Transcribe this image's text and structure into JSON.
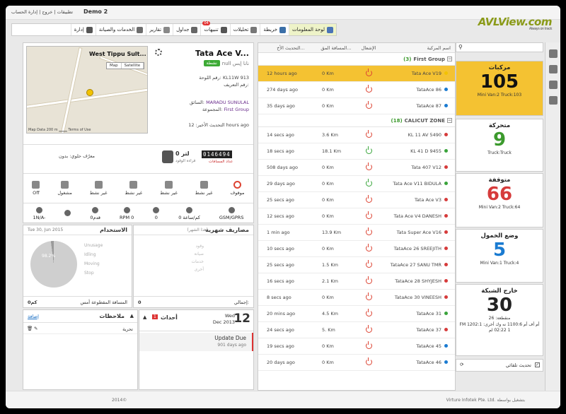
{
  "top": {
    "links": "تطبيقات | خروج | إدارة الحساب",
    "company": "Demo 2",
    "logo": "AVLView.com",
    "logo_tagline": "Always on track"
  },
  "menu": [
    {
      "label": "لوحة المعلومات",
      "icon": "dashboard-icon",
      "active": true
    },
    {
      "label": "خريطة",
      "icon": "globe-icon"
    },
    {
      "label": "تحليلات",
      "icon": "chart-icon"
    },
    {
      "label": "تنبيهات",
      "icon": "warning-icon",
      "badge": "04"
    },
    {
      "label": "جداول",
      "icon": "table-icon"
    },
    {
      "label": "تقارير",
      "icon": "report-icon"
    },
    {
      "label": "الخدمات والصيانة",
      "icon": "tools-icon"
    },
    {
      "label": "إدارة",
      "icon": "gear-icon"
    }
  ],
  "vehicle": {
    "name": "Tata Ace V...",
    "sub": "null نانا إيس",
    "status": "نشطة",
    "map_title": "West Tippu Sult...",
    "map_btns": [
      "Map",
      "Satellite"
    ],
    "map_footer": "Map Data   200 m ▁▁▁   Terms of Use",
    "plate_label": "رقم اللوحة:",
    "plate": "KL11W 913",
    "id_label": "رقم التعريف:",
    "id": "",
    "driver_label": "السائق:",
    "driver": "MARADU SUNULAL",
    "group_label": "المجموعة:",
    "group": "First Group",
    "update_label": "التحديث الأخير:",
    "update": "12 hours ago",
    "fuel": "0 لتر",
    "fuel_sub": "قراءة الوقود",
    "odo": "0146494",
    "odo_sub": "عداد المسافات",
    "tracker": "معرّف حلوي: بدون",
    "status_icons": [
      {
        "label": "موقوف",
        "icon": "power-icon",
        "active": true
      },
      {
        "label": "غير نشط",
        "icon": "driver-icon"
      },
      {
        "label": "غير نشط",
        "icon": "seat-icon"
      },
      {
        "label": "غير نشط",
        "icon": "snowflake-icon"
      },
      {
        "label": "غير نشط",
        "icon": "thermometer-icon"
      },
      {
        "label": "مشغول",
        "icon": "truck-icon"
      },
      {
        "label": "Off",
        "icon": "engine-icon"
      }
    ],
    "sensors": [
      {
        "value": "GSM/GPRS",
        "icon": "signal-icon"
      },
      {
        "value": "0 كم/ساعة",
        "icon": "speed-icon"
      },
      {
        "value": "0",
        "icon": "wrench-icon"
      },
      {
        "value": "RPM 0",
        "icon": "rpm-icon"
      },
      {
        "value": "0قدم",
        "icon": "altitude-icon"
      },
      {
        "value": "",
        "icon": "temp-icon"
      },
      {
        "value": "1N/A-",
        "icon": "battery-icon"
      }
    ]
  },
  "usage": {
    "title": "الاستخدام",
    "date": "Tue 30, Jun 2015",
    "legend": [
      "Unusage",
      "Idling",
      "Moving",
      "Stop"
    ],
    "percent": "98.2%",
    "distance_label": "المسافة المقطوعة أمس",
    "distance": "0كم"
  },
  "expenses": {
    "title": "مصاريف شهرية",
    "period": "(هذا الشهر)",
    "rows": [
      "وقود",
      "صيانة",
      "خدمات",
      "أخرى"
    ],
    "total_label": "إجمالي:",
    "total": "0"
  },
  "events": {
    "day": "12",
    "weekday": "Wed",
    "month": "Dec 2013",
    "title": "أحداث",
    "badge": "1",
    "item": "Update Due",
    "item_sub": "901 days ago"
  },
  "notes": {
    "title": "ملاحظات",
    "add": "إضافة",
    "col": "تحرية"
  },
  "list": {
    "search_placeholder": "",
    "headers": [
      "اسم المركبة",
      "الإشعال",
      "المسافة المق...",
      "التحديث الأخ..."
    ],
    "groups": [
      {
        "name": "First Group",
        "count": "(3)",
        "rows": [
          {
            "name": "Tata Ace V19",
            "on": false,
            "dist": "0 Km",
            "time": "12 hours ago",
            "sel": true,
            "dot": "#f2c200"
          },
          {
            "name": "TataAce 86",
            "on": false,
            "dist": "0 Km",
            "time": "274 days ago",
            "dot": "#1a7bd1"
          },
          {
            "name": "TataAce 87",
            "on": false,
            "dist": "0 Km",
            "time": "35 days ago",
            "dot": "#1a7bd1"
          }
        ]
      },
      {
        "name": "CALICUT ZONE",
        "count": "(18)",
        "rows": [
          {
            "name": "KL 11 AV 5490",
            "on": false,
            "dist": "3.6 Km",
            "time": "14 secs ago",
            "dot": "#d63b3b"
          },
          {
            "name": "KL 41 D 9455",
            "on": true,
            "dist": "18.1 Km",
            "time": "18 secs ago",
            "dot": "#3aa33b"
          },
          {
            "name": "Tata 407 V12",
            "on": false,
            "dist": "0 Km",
            "time": "508 days ago",
            "dot": "#d63b3b"
          },
          {
            "name": "Tata Ace V11 BIDULA",
            "on": true,
            "dist": "0 Km",
            "time": "29 days ago",
            "dot": "#3aa33b"
          },
          {
            "name": "Tata Ace V3",
            "on": false,
            "dist": "0 Km",
            "time": "25 secs ago",
            "dot": "#d63b3b"
          },
          {
            "name": "Tata Ace V4 DANESH",
            "on": false,
            "dist": "0 Km",
            "time": "12 secs ago",
            "dot": "#d63b3b"
          },
          {
            "name": "Tata Super Ace V16",
            "on": false,
            "dist": "13.9 Km",
            "time": "1 min ago",
            "dot": "#d63b3b"
          },
          {
            "name": "TataAce 26 SREEJITH",
            "on": false,
            "dist": "0 Km",
            "time": "10 secs ago",
            "dot": "#d63b3b"
          },
          {
            "name": "TataAce 27 SANU TMR",
            "on": false,
            "dist": "1.5 Km",
            "time": "25 secs ago",
            "dot": "#d63b3b"
          },
          {
            "name": "TataAce 28 SHYJESH",
            "on": false,
            "dist": "2.1 Km",
            "time": "16 secs ago",
            "dot": "#d63b3b"
          },
          {
            "name": "TataAce 30 VINEESH",
            "on": false,
            "dist": "0 Km",
            "time": "8 secs ago",
            "dot": "#d63b3b"
          },
          {
            "name": "TataAce 31",
            "on": false,
            "dist": "4.5 Km",
            "time": "20 mins ago",
            "dot": "#3aa33b"
          },
          {
            "name": "TataAce 37",
            "on": false,
            "dist": "5. Km",
            "time": "24 secs ago",
            "dot": "#d63b3b"
          },
          {
            "name": "TataAce 45",
            "on": false,
            "dist": "0 Km",
            "time": "19 secs ago",
            "dot": "#1a7bd1"
          },
          {
            "name": "TataAce 46",
            "on": false,
            "dist": "0 Km",
            "time": "20 days ago",
            "dot": "#1a7bd1"
          }
        ]
      }
    ]
  },
  "stats": [
    {
      "title": "مركبات",
      "number": "105",
      "sub": "Mini Van:2 Truck:103",
      "color": "#111",
      "bg": "#f4c232"
    },
    {
      "title": "متحركة",
      "number": "9",
      "sub": "Truck:Truck",
      "color": "#3c9a2d",
      "bg": "#fff"
    },
    {
      "title": "متوقفة",
      "number": "66",
      "sub": "Mini Van:2 Truck:64",
      "color": "#d63b3b",
      "bg": "#fff"
    },
    {
      "title": "وضع الخمول",
      "number": "5",
      "sub": "Mini Van:1 Truck:4",
      "color": "#1a7bd1",
      "bg": "#fff"
    },
    {
      "title": "خارج الشبكة",
      "number": "30",
      "sub": "منقطعة: 26",
      "color": "#222",
      "bg": "#fff",
      "extra": "FM 1202:1 أم أف أم 1100:6 نه وك أخرى: 1 02:22 لم"
    }
  ],
  "auto_refresh": "تحديث تلقائي",
  "footer": {
    "left": "Virture Infotek Pte. Ltd. بتشغيل بواسطة",
    "right": "2014©"
  }
}
